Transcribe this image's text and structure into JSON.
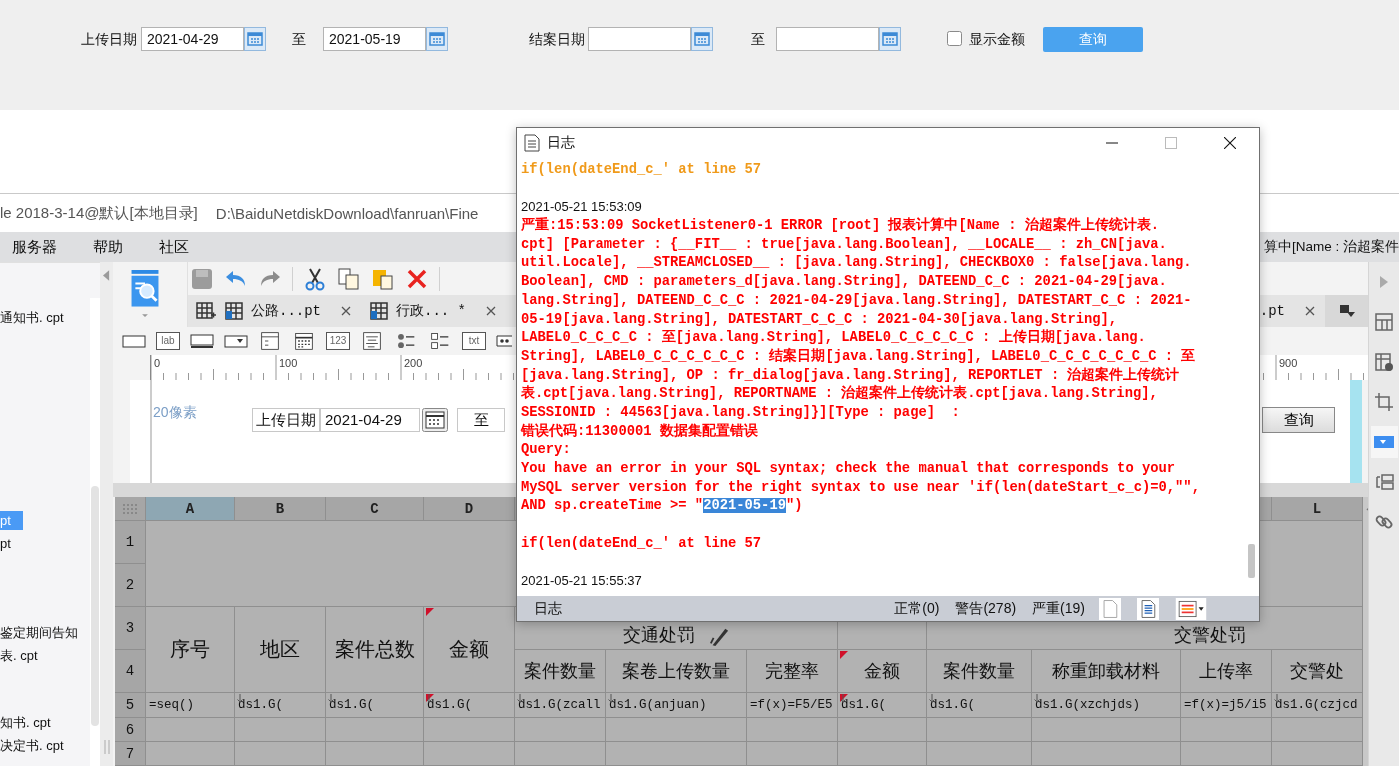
{
  "query_form": {
    "upload_date": {
      "label": "上传日期",
      "from": "2021-04-29",
      "separator": "至",
      "to": "2021-05-19"
    },
    "close_date": {
      "label": "结案日期",
      "separator": "至"
    },
    "show_amount": {
      "label": "显示金额",
      "checked": false
    },
    "query_button": "查询"
  },
  "designer": {
    "title": {
      "project": "le 2018-3-14@默认[本地目录]",
      "path": "D:\\BaiduNetdiskDownload\\fanruan\\Fine"
    },
    "menu": [
      "服务器",
      "帮助",
      "社区"
    ],
    "menu_bar_note": "算中[Name : 治超案件",
    "file_tree": [
      {
        "kind": "file",
        "label": "通知书. cpt",
        "selected": false
      },
      {
        "kind": "blank"
      },
      {
        "kind": "blank"
      },
      {
        "kind": "blank"
      },
      {
        "kind": "blank"
      },
      {
        "kind": "blank"
      },
      {
        "kind": "blank"
      },
      {
        "kind": "blank"
      },
      {
        "kind": "blank"
      },
      {
        "kind": "file",
        "label": "pt",
        "selected": true
      },
      {
        "kind": "file",
        "label": "pt",
        "selected": false
      },
      {
        "kind": "blank"
      },
      {
        "kind": "blank"
      },
      {
        "kind": "blank"
      },
      {
        "kind": "file",
        "label": "鉴定期间告知",
        "selected": false
      },
      {
        "kind": "file",
        "label": "表. cpt",
        "selected": false
      },
      {
        "kind": "blank"
      },
      {
        "kind": "blank"
      },
      {
        "kind": "file",
        "label": "知书. cpt",
        "selected": false
      },
      {
        "kind": "file",
        "label": "决定书. cpt",
        "selected": false
      }
    ],
    "tabs": [
      {
        "label": "公路...pt",
        "selected": false
      },
      {
        "label": "行政... *",
        "selected": false
      },
      {
        "label": ".pt",
        "selected": false
      }
    ],
    "widget_bar": [
      {
        "kind": "textbox"
      },
      {
        "kind": "label",
        "text": "lab"
      },
      {
        "kind": "button"
      },
      {
        "kind": "combo"
      },
      {
        "kind": "form"
      },
      {
        "kind": "date"
      },
      {
        "kind": "number",
        "text": "123"
      },
      {
        "kind": "list"
      },
      {
        "kind": "radio"
      },
      {
        "kind": "checkbox"
      },
      {
        "kind": "textarea",
        "text": "txt"
      },
      {
        "kind": "more"
      }
    ],
    "ruler_labels": [
      "0",
      "100",
      "200",
      "900"
    ],
    "canvas": {
      "note": "20像素",
      "date_label": "上传日期",
      "date_value": "2021-04-29",
      "separator": "至",
      "button": "查询"
    }
  },
  "spreadsheet": {
    "column_headers": [
      {
        "label": "A",
        "selected": true
      },
      {
        "label": "B",
        "selected": false
      },
      {
        "label": "C",
        "selected": false
      },
      {
        "label": "D",
        "selected": false
      },
      {
        "label": "L",
        "selected": false
      }
    ],
    "row_numbers": [
      "1",
      "2",
      "3",
      "4",
      "5",
      "6",
      "7"
    ],
    "title_headers": [
      {
        "text": "序号",
        "flagged": false
      },
      {
        "text": "地区",
        "flagged": false
      },
      {
        "text": "案件总数",
        "flagged": false
      },
      {
        "text": "金额",
        "flagged": true
      }
    ],
    "group_headers": [
      "交通处罚",
      "交警处罚"
    ],
    "sub_headers": [
      {
        "text": "案件数量",
        "flagged": false
      },
      {
        "text": "案卷上传数量",
        "flagged": false
      },
      {
        "text": "完整率",
        "flagged": false
      },
      {
        "text": "金额",
        "flagged": true
      },
      {
        "text": "案件数量",
        "flagged": false
      },
      {
        "text": "称重卸载材料",
        "flagged": false
      },
      {
        "text": "上传率",
        "flagged": false
      },
      {
        "text": "交警处",
        "flagged": false
      }
    ],
    "formula_row": [
      {
        "text": "=seq()",
        "expands": false,
        "flagged": false
      },
      {
        "text": "ds1.G(",
        "expands": true,
        "flagged": false
      },
      {
        "text": "ds1.G(",
        "expands": true,
        "flagged": false
      },
      {
        "text": "ds1.G(",
        "expands": true,
        "flagged": true
      },
      {
        "text": "ds1.G(zcall",
        "expands": true,
        "flagged": false
      },
      {
        "text": "ds1.G(anjuan)",
        "expands": true,
        "flagged": false
      },
      {
        "text": "=f(x)=F5/E5",
        "expands": false,
        "flagged": false
      },
      {
        "text": "ds1.G(",
        "expands": true,
        "flagged": true
      },
      {
        "text": "ds1.G(",
        "expands": true,
        "flagged": false
      },
      {
        "text": "ds1.G(xzchjds)",
        "expands": true,
        "flagged": false
      },
      {
        "text": "=f(x)=j5/i5",
        "expands": false,
        "flagged": false
      },
      {
        "text": "ds1.G(czjcd",
        "expands": true,
        "flagged": false
      }
    ]
  },
  "log_window": {
    "title": "日志",
    "entries": [
      {
        "kind": "warning",
        "lines": [
          {
            "text": "if(len(dateEnd_c_' at line 57"
          }
        ]
      },
      {
        "kind": "time",
        "lines": [
          {
            "text": "2021-05-21 15:53:09"
          }
        ]
      },
      {
        "kind": "error",
        "lines": [
          {
            "text": "严重:15:53:09 SocketListener0-1 ERROR [root] 报表计算中[Name : 治超案件上传统计表."
          },
          {
            "text": "cpt] [Parameter : {__FIT__ : true[java.lang.Boolean], __LOCALE__ : zh_CN[java."
          },
          {
            "text": "util.Locale], __STREAMCLOSED__ : [java.lang.String], CHECKBOX0 : false[java.lang."
          },
          {
            "text": "Boolean], CMD : parameters_d[java.lang.String], DATEEND_C_C : 2021-04-29[java."
          },
          {
            "text": "lang.String], DATEEND_C_C_C : 2021-04-29[java.lang.String], DATESTART_C_C : 2021-"
          },
          {
            "text": "05-19[java.lang.String], DATESTART_C_C_C : 2021-04-30[java.lang.String],"
          },
          {
            "text": "LABEL0_C_C_C_C : 至[java.lang.String], LABEL0_C_C_C_C_C : 上传日期[java.lang."
          },
          {
            "text": "String], LABEL0_C_C_C_C_C_C : 结案日期[java.lang.String], LABEL0_C_C_C_C_C_C_C : 至"
          },
          {
            "text": "[java.lang.String], OP : fr_dialog[java.lang.String], REPORTLET : 治超案件上传统计"
          },
          {
            "text": "表.cpt[java.lang.String], REPORTNAME : 治超案件上传统计表.cpt[java.lang.String],"
          },
          {
            "text": "SESSIONID : 44563[java.lang.String]}][Type : page]  :"
          },
          {
            "text": "错误代码:11300001 数据集配置错误"
          },
          {
            "text": "Query:"
          },
          {
            "text": "You have an error in your SQL syntax; check the manual that corresponds to your"
          },
          {
            "text": "MySQL server version for the right syntax to use near 'if(len(dateStart_c_c)=0,\"\","
          },
          {
            "segments": [
              {
                "text": "AND sp.createTime >= \"",
                "selected": false
              },
              {
                "text": "2021-05-19",
                "selected": true
              },
              {
                "text": "\")",
                "selected": false
              }
            ]
          }
        ]
      },
      {
        "kind": "error",
        "lines": [
          {
            "text": "if(len(dateEnd_c_' at line 57"
          }
        ]
      },
      {
        "kind": "time",
        "lines": [
          {
            "text": "2021-05-21 15:55:37"
          }
        ]
      }
    ],
    "status_bar": {
      "label": "日志",
      "normal": "正常(0)",
      "warning": "警告(278)",
      "severe": "严重(19)"
    }
  }
}
